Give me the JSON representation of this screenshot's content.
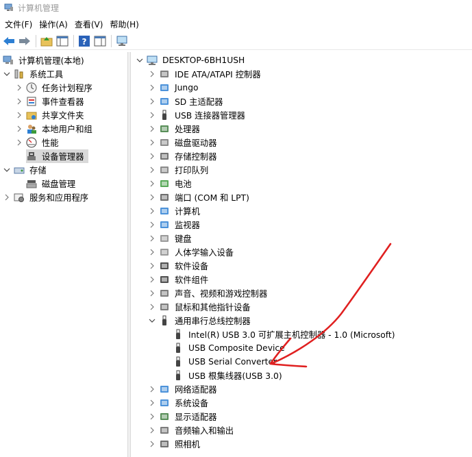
{
  "window": {
    "title": "计算机管理"
  },
  "menubar": {
    "items": [
      "文件(F)",
      "操作(A)",
      "查看(V)",
      "帮助(H)"
    ]
  },
  "left_tree": {
    "root": "计算机管理(本地)",
    "system_tools": "系统工具",
    "task_scheduler": "任务计划程序",
    "event_viewer": "事件查看器",
    "shared_folders": "共享文件夹",
    "local_users": "本地用户和组",
    "performance": "性能",
    "device_manager": "设备管理器",
    "storage": "存储",
    "disk_management": "磁盘管理",
    "services_apps": "服务和应用程序"
  },
  "device_tree": {
    "root": "DESKTOP-6BH1USH",
    "categories": {
      "ide": "IDE ATA/ATAPI 控制器",
      "jungo": "Jungo",
      "sd": "SD 主适配器",
      "usb_connector": "USB 连接器管理器",
      "processor": "处理器",
      "disk_drives": "磁盘驱动器",
      "storage_ctrl": "存储控制器",
      "print_queue": "打印队列",
      "battery": "电池",
      "ports": "端口 (COM 和 LPT)",
      "computer": "计算机",
      "monitor": "监视器",
      "keyboard": "键盘",
      "hid": "人体学输入设备",
      "software_devices": "软件设备",
      "software_components": "软件组件",
      "sound": "声音、视频和游戏控制器",
      "mice": "鼠标和其他指针设备",
      "usb_bus": "通用串行总线控制器",
      "network": "网络适配器",
      "system_devices": "系统设备",
      "display": "显示适配器",
      "audio_io": "音频输入和输出",
      "camera": "照相机"
    },
    "usb_children": {
      "intel": "Intel(R) USB 3.0 可扩展主机控制器 - 1.0 (Microsoft)",
      "composite": "USB Composite Device",
      "serial": "USB Serial Converter",
      "root_hub": "USB 根集线器(USB 3.0)"
    }
  },
  "annotation": {
    "color": "#e02020"
  }
}
